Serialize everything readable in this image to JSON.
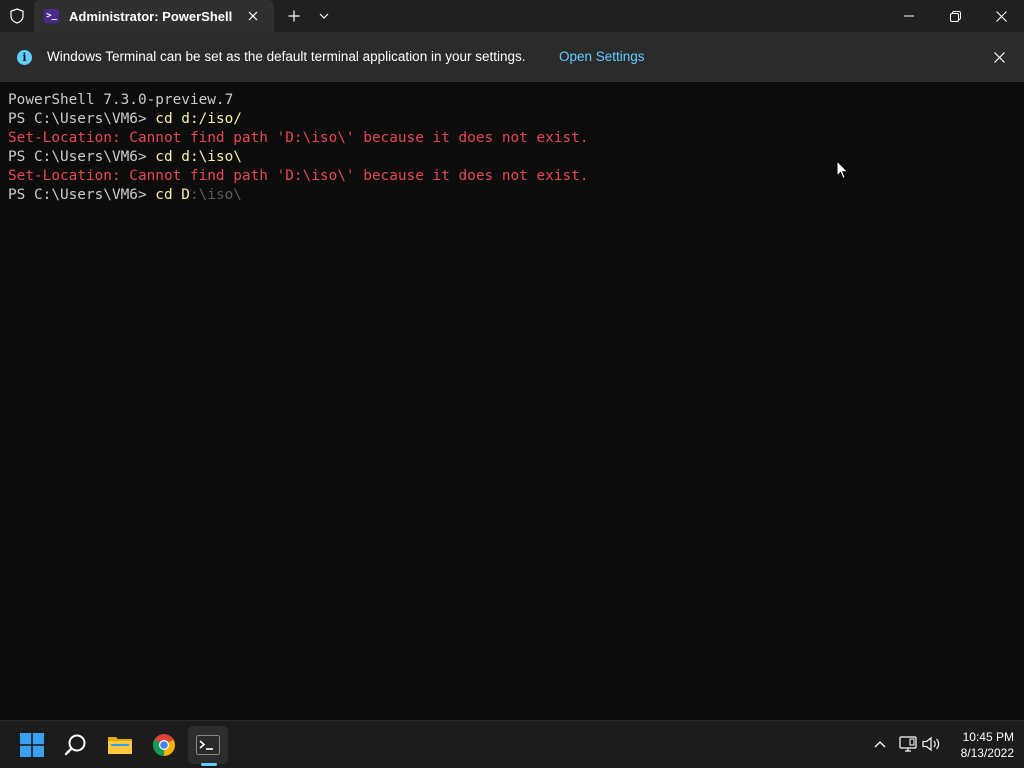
{
  "window": {
    "tab_title": "Administrator: PowerShell"
  },
  "infobar": {
    "message": "Windows Terminal can be set as the default terminal application in your settings.",
    "link_label": "Open Settings"
  },
  "terminal": {
    "lines": [
      {
        "text": "PowerShell 7.3.0-preview.7"
      },
      {
        "prompt": "PS C:\\Users\\VM6> ",
        "command": "cd d:/iso/"
      },
      {
        "error": "Set-Location: Cannot find path 'D:\\iso\\' because it does not exist."
      },
      {
        "prompt": "PS C:\\Users\\VM6> ",
        "command": "cd d:\\iso\\"
      },
      {
        "error": "Set-Location: Cannot find path 'D:\\iso\\' because it does not exist."
      },
      {
        "prompt": "PS C:\\Users\\VM6> ",
        "command": "cd D",
        "suggestion": ":\\iso\\"
      }
    ]
  },
  "taskbar": {
    "apps": [
      "start-button",
      "search",
      "file-explorer",
      "chrome",
      "terminal"
    ],
    "time": "10:45 PM",
    "date": "8/13/2022"
  },
  "colors": {
    "background": "#0c0c0c",
    "output": "#cccccc",
    "command": "#f9f1a5",
    "error": "#e74856",
    "suggestion": "#5a5a5a",
    "accent": "#60cdff"
  }
}
